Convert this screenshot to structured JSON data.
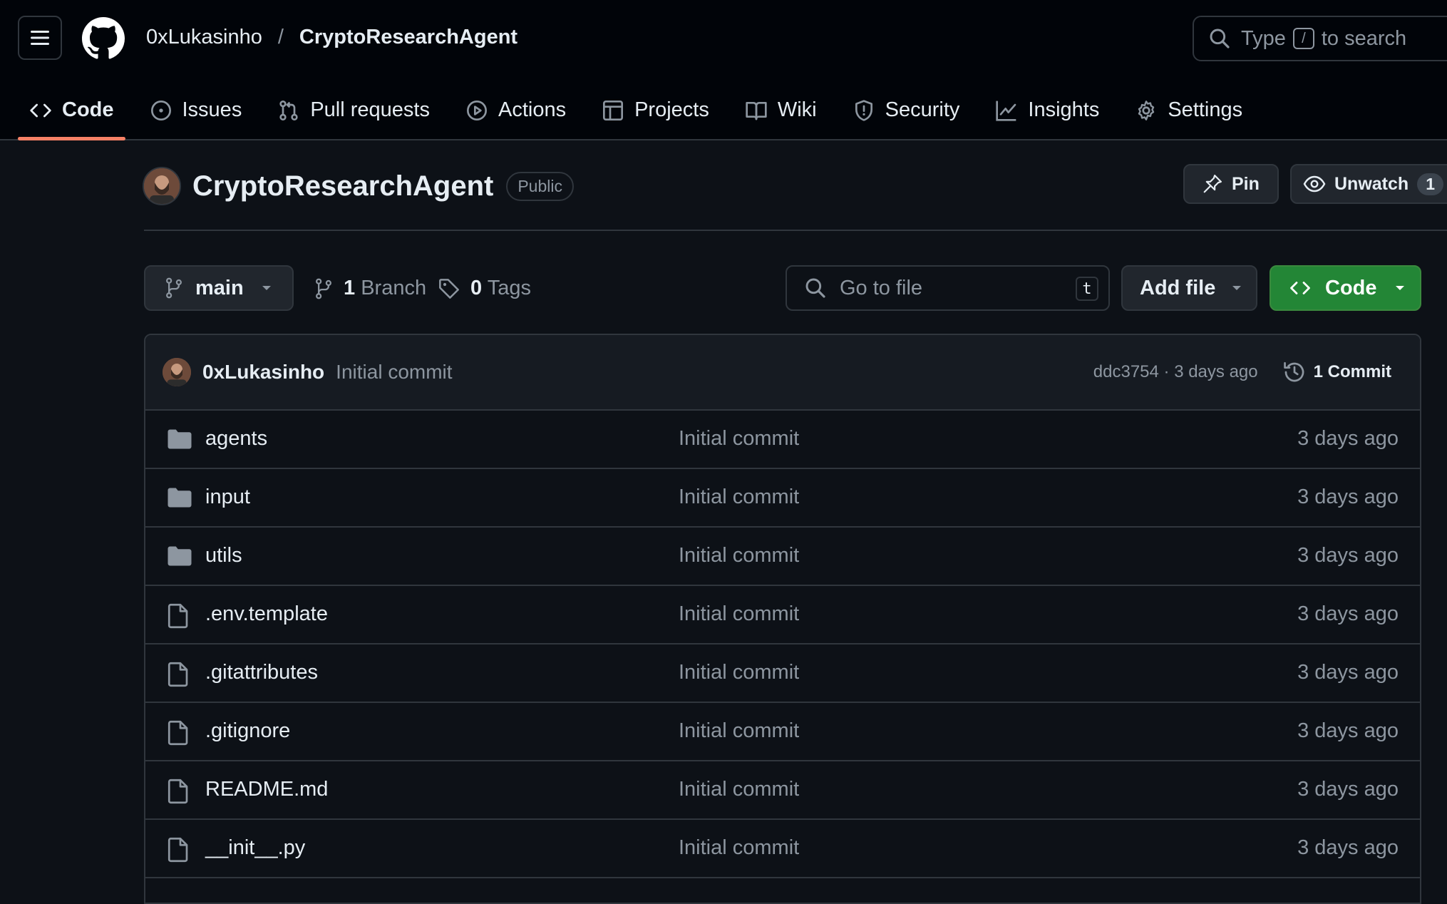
{
  "header": {
    "owner": "0xLukasinho",
    "separator": "/",
    "repo": "CryptoResearchAgent",
    "search_prefix": "Type",
    "search_key": "/",
    "search_suffix": "to search"
  },
  "tabs": [
    {
      "label": "Code",
      "icon": "code-icon",
      "active": true
    },
    {
      "label": "Issues",
      "icon": "issue-icon"
    },
    {
      "label": "Pull requests",
      "icon": "pull-request-icon"
    },
    {
      "label": "Actions",
      "icon": "play-icon"
    },
    {
      "label": "Projects",
      "icon": "table-icon"
    },
    {
      "label": "Wiki",
      "icon": "book-icon"
    },
    {
      "label": "Security",
      "icon": "shield-icon"
    },
    {
      "label": "Insights",
      "icon": "graph-icon"
    },
    {
      "label": "Settings",
      "icon": "gear-icon"
    }
  ],
  "repo_header": {
    "name": "CryptoResearchAgent",
    "visibility": "Public",
    "pin_label": "Pin",
    "unwatch_label": "Unwatch",
    "watch_count": "1"
  },
  "toolbar": {
    "branch": "main",
    "branch_count": "1",
    "branch_label": "Branch",
    "tag_count": "0",
    "tag_label": "Tags",
    "goto_placeholder": "Go to file",
    "goto_key": "t",
    "add_file_label": "Add file",
    "code_label": "Code"
  },
  "latest_commit": {
    "author": "0xLukasinho",
    "message": "Initial commit",
    "hash_time": "ddc3754 · 3 days ago",
    "commit_count": "1",
    "commit_label": "Commit"
  },
  "files": [
    {
      "name": "agents",
      "type": "folder",
      "message": "Initial commit",
      "date": "3 days ago"
    },
    {
      "name": "input",
      "type": "folder",
      "message": "Initial commit",
      "date": "3 days ago"
    },
    {
      "name": "utils",
      "type": "folder",
      "message": "Initial commit",
      "date": "3 days ago"
    },
    {
      "name": ".env.template",
      "type": "file",
      "message": "Initial commit",
      "date": "3 days ago"
    },
    {
      "name": ".gitattributes",
      "type": "file",
      "message": "Initial commit",
      "date": "3 days ago"
    },
    {
      "name": ".gitignore",
      "type": "file",
      "message": "Initial commit",
      "date": "3 days ago"
    },
    {
      "name": "README.md",
      "type": "file",
      "message": "Initial commit",
      "date": "3 days ago"
    },
    {
      "name": "__init__.py",
      "type": "file",
      "message": "Initial commit",
      "date": "3 days ago"
    }
  ],
  "colors": {
    "background": "#0d1117",
    "header_bg": "#010409",
    "border": "#30363d",
    "accent_underline": "#f78166",
    "code_button": "#238636",
    "muted_text": "#8d96a0"
  }
}
